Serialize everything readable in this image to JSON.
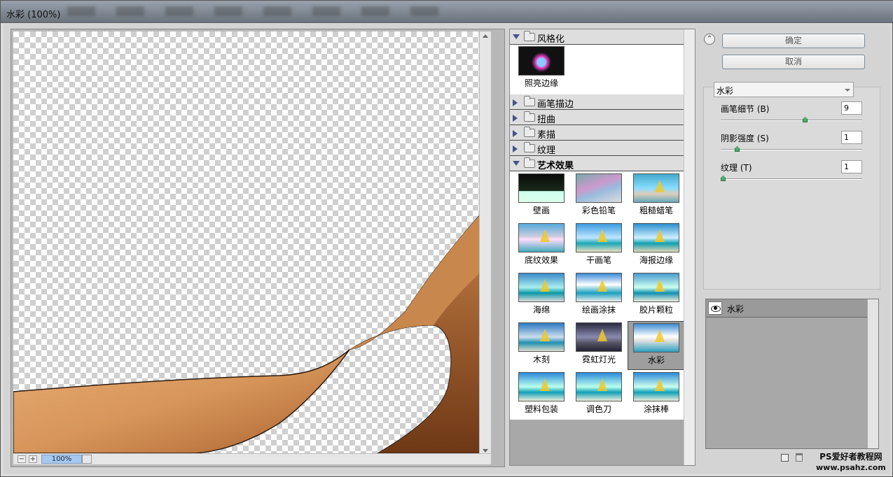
{
  "window": {
    "title": "水彩 (100%)"
  },
  "preview": {
    "zoom": "100%",
    "zoom_out": "−",
    "zoom_in": "+"
  },
  "filter_gallery": {
    "categories": [
      {
        "name": "风格化",
        "expanded": true,
        "items": [
          "照亮边缘"
        ]
      },
      {
        "name": "画笔描边",
        "expanded": false
      },
      {
        "name": "扭曲",
        "expanded": false
      },
      {
        "name": "素描",
        "expanded": false
      },
      {
        "name": "纹理",
        "expanded": false
      },
      {
        "name": "艺术效果",
        "expanded": true,
        "items": [
          "壁画",
          "彩色铅笔",
          "粗糙蜡笔",
          "底纹效果",
          "干画笔",
          "海报边缘",
          "海绵",
          "绘画涂抹",
          "胶片颗粒",
          "木刻",
          "霓虹灯光",
          "水彩",
          "塑料包装",
          "调色刀",
          "涂抹棒"
        ],
        "selected": "水彩"
      }
    ]
  },
  "buttons": {
    "ok": "确定",
    "cancel": "取消"
  },
  "settings": {
    "filter_select": "水彩",
    "params": [
      {
        "label": "画笔细节 (B)",
        "value": "9",
        "level": 0.6
      },
      {
        "label": "阴影强度 (S)",
        "value": "1",
        "level": 0.1
      },
      {
        "label": "纹理 (T)",
        "value": "1",
        "level": 0.0
      }
    ]
  },
  "layers": {
    "name": "水彩"
  },
  "watermark": {
    "line1": "PS爱好者教程网",
    "line2": "www.psahz.com"
  },
  "colors": {
    "skin": "#d7955a",
    "accent_green": "#4cae6c",
    "category_arrow": "#44548a"
  }
}
